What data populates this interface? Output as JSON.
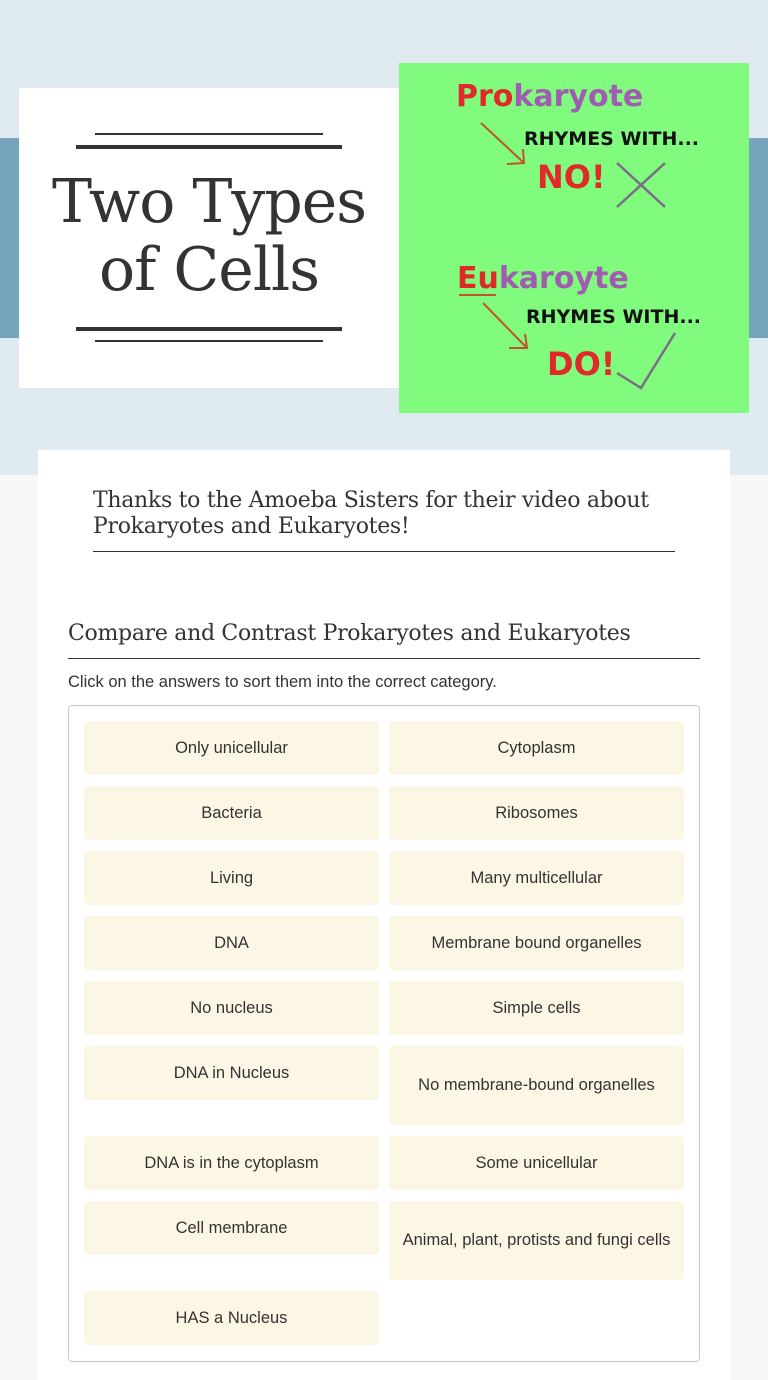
{
  "header": {
    "title_line1": "Two Types",
    "title_line2": "of Cells"
  },
  "hero_image": {
    "description": "Prokaryote rhymes with NO, Eukaryote rhymes with DO mnemonic",
    "prokaryote_word": "Prokaryote",
    "prokaryote_rhyme": "RHYMES WITH...",
    "prokaryote_answer": "NO!",
    "eukaryote_word": "Eukaroyte",
    "eukaryote_rhyme": "RHYMES WITH...",
    "eukaryote_answer": "DO!",
    "colors": {
      "background": "#80fb7d",
      "red": "#e02a2a",
      "purple": "#a05cb0",
      "gray": "#7a6f86"
    }
  },
  "intro": {
    "text": "Thanks to the Amoeba Sisters for their video about Prokaryotes and Eukaryotes!"
  },
  "section": {
    "title": "Compare and Contrast Prokaryotes and Eukaryotes",
    "instructions": "Click on the answers to sort them into the correct category."
  },
  "answers": [
    {
      "label": "Only unicellular"
    },
    {
      "label": "Cytoplasm"
    },
    {
      "label": "Bacteria"
    },
    {
      "label": "Ribosomes"
    },
    {
      "label": "Living"
    },
    {
      "label": "Many multicellular"
    },
    {
      "label": "DNA"
    },
    {
      "label": "Membrane bound organelles"
    },
    {
      "label": "No nucleus"
    },
    {
      "label": "Simple cells"
    },
    {
      "label": "DNA in Nucleus"
    },
    {
      "label": "No membrane-bound organelles"
    },
    {
      "label": "DNA is in the cytoplasm"
    },
    {
      "label": "Some unicellular"
    },
    {
      "label": "Cell membrane"
    },
    {
      "label": "Animal, plant, protists and fungi cells"
    },
    {
      "label": "HAS a Nucleus"
    }
  ],
  "colors": {
    "hero_bg": "#dfebf1",
    "hero_band": "#75a5bc",
    "chip_bg": "#fcf7e4",
    "text": "#333333"
  }
}
